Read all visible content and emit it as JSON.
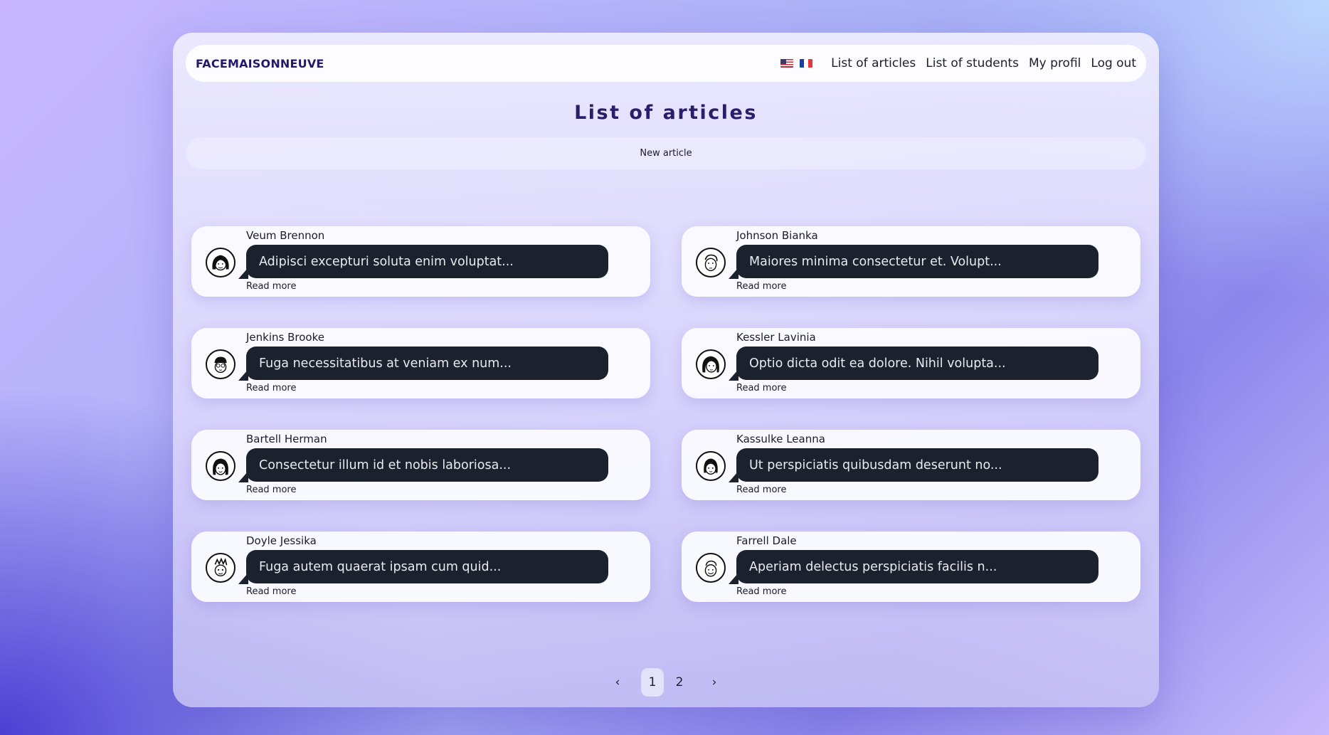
{
  "brand": "FACEMAISONNEUVE",
  "nav": {
    "flags": [
      "us-flag-icon",
      "fr-flag-icon"
    ],
    "links": [
      "List of articles",
      "List of students",
      "My profil",
      "Log out"
    ]
  },
  "page_title": "List of articles",
  "new_article_label": "New article",
  "articles": [
    {
      "author": "Veum Brennon",
      "excerpt": "Adipisci excepturi soluta enim voluptat...",
      "read_more": "Read more"
    },
    {
      "author": "Johnson Bianka",
      "excerpt": "Maiores minima consectetur et. Volupt...",
      "read_more": "Read more"
    },
    {
      "author": "Jenkins Brooke",
      "excerpt": "Fuga necessitatibus at veniam ex num...",
      "read_more": "Read more"
    },
    {
      "author": "Kessler Lavinia",
      "excerpt": "Optio dicta odit ea dolore. Nihil volupta...",
      "read_more": "Read more"
    },
    {
      "author": "Bartell Herman",
      "excerpt": "Consectetur illum id et nobis laboriosa...",
      "read_more": "Read more"
    },
    {
      "author": "Kassulke Leanna",
      "excerpt": "Ut perspiciatis quibusdam deserunt no...",
      "read_more": "Read more"
    },
    {
      "author": "Doyle Jessika",
      "excerpt": "Fuga autem quaerat ipsam cum quid...",
      "read_more": "Read more"
    },
    {
      "author": "Farrell Dale",
      "excerpt": "Aperiam delectus perspiciatis facilis n...",
      "read_more": "Read more"
    }
  ],
  "pagination": {
    "prev": "‹",
    "pages": [
      "1",
      "2"
    ],
    "current": "1",
    "next": "›"
  },
  "colors": {
    "brand": "#24186a",
    "title": "#2b1d6a",
    "bubble": "#1c222d"
  }
}
